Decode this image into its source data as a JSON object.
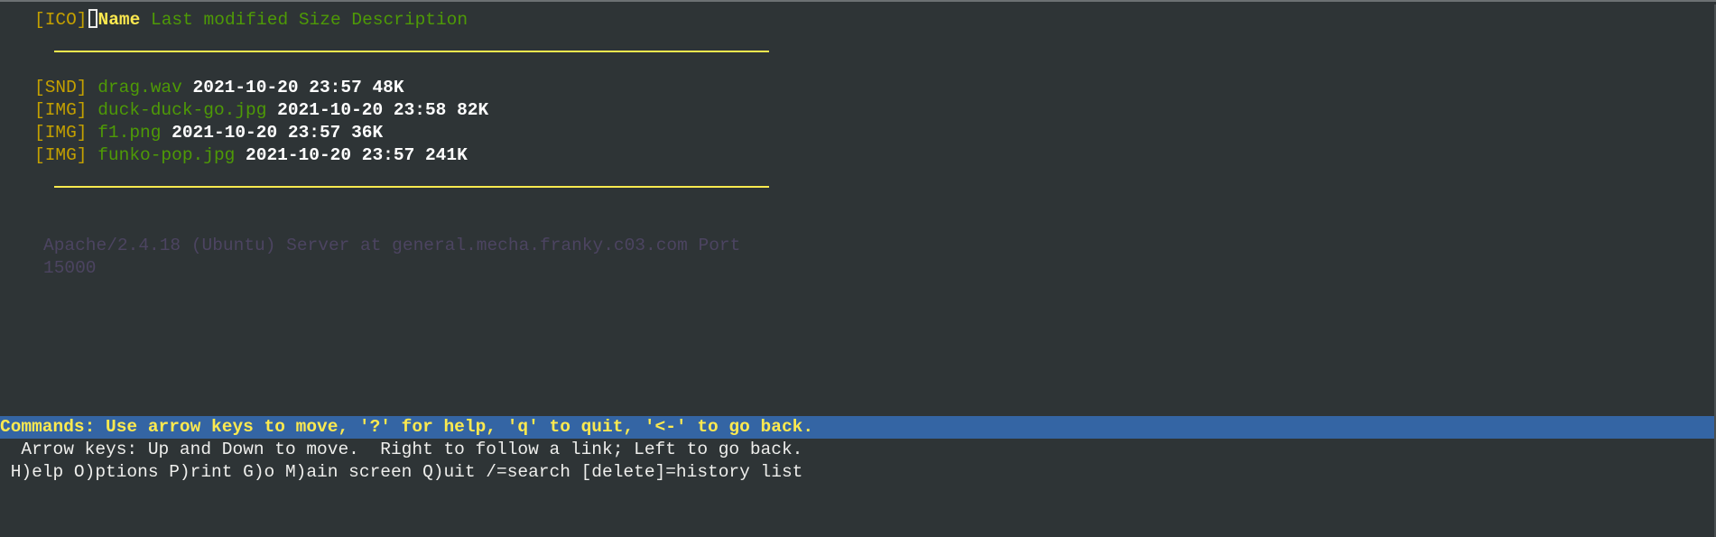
{
  "header": {
    "icon_tag": "[ICO]",
    "columns": {
      "name": "Name",
      "rest": "Last modified Size Description"
    }
  },
  "files": [
    {
      "tag": "[SND]",
      "name": "drag.wav",
      "modified": "2021-10-20 23:57",
      "size": "48K"
    },
    {
      "tag": "[IMG]",
      "name": "duck-duck-go.jpg",
      "modified": "2021-10-20 23:58",
      "size": "82K"
    },
    {
      "tag": "[IMG]",
      "name": "f1.png",
      "modified": "2021-10-20 23:57",
      "size": "36K"
    },
    {
      "tag": "[IMG]",
      "name": "funko-pop.jpg",
      "modified": "2021-10-20 23:57",
      "size": "241K"
    }
  ],
  "footer": {
    "server_line1": "Apache/2.4.18 (Ubuntu) Server at general.mecha.franky.c03.com Port",
    "server_line2": "15000"
  },
  "statusbar": {
    "commands": "Commands: Use arrow keys to move, '?' for help, 'q' to quit, '<-' to go back.",
    "arrow_help": "  Arrow keys: Up and Down to move.  Right to follow a link; Left to go back.",
    "key_help": " H)elp O)ptions P)rint G)o M)ain screen Q)uit /=search [delete]=history list"
  },
  "colors": {
    "background": "#2e3436",
    "tag": "#c4a000",
    "link": "#4e9a06",
    "status_bar": "#3465a4",
    "status_text": "#fce94f"
  }
}
